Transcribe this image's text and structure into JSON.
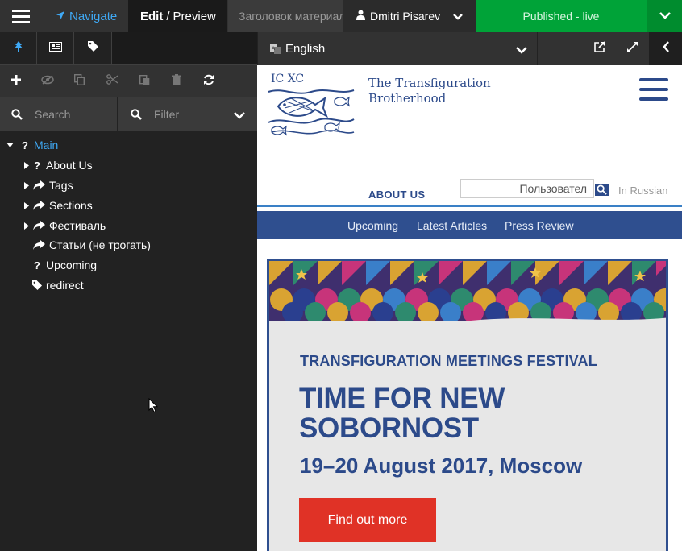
{
  "topbar": {
    "navigate_label": "Navigate",
    "edit_label": "Edit",
    "preview_label": "Preview",
    "edit_separator": "/",
    "title_field": "Заголовок материал",
    "user_name": "Dmitri Pisarev",
    "publish_status": "Published - live"
  },
  "sidebar": {
    "search_placeholder": "Search",
    "filter_placeholder": "Filter",
    "tree": [
      {
        "label": "Main",
        "icon": "question-icon",
        "expanded": true,
        "active": true
      },
      {
        "label": "About Us",
        "icon": "question-icon"
      },
      {
        "label": "Tags",
        "icon": "share-icon"
      },
      {
        "label": "Sections",
        "icon": "share-icon"
      },
      {
        "label": "Фестиваль",
        "icon": "share-icon"
      },
      {
        "label": "Статьи (не трогать)",
        "icon": "share-icon"
      },
      {
        "label": "Upcoming",
        "icon": "question-icon"
      },
      {
        "label": "redirect",
        "icon": "tag-icon"
      }
    ]
  },
  "preview": {
    "language": "English",
    "site": {
      "logo_line1": "The Transfiguration",
      "logo_line2": "Brotherhood",
      "logo_mark": "IC XC",
      "about_link": "ABOUT US",
      "user_field": "Пользовател",
      "in_russian": "In Russian",
      "nav": [
        "Upcoming",
        "Latest Articles",
        "Press Review"
      ],
      "banner": {
        "festival": "TRANSFIGURATION MEETINGS FESTIVAL",
        "headline_line1": "TIME FOR NEW",
        "headline_line2": "SOBORNOST",
        "date": "19–20 August 2017, Moscow",
        "cta": "Find out more"
      }
    }
  },
  "colors": {
    "accent_blue": "#3fa9f5",
    "publish_green": "#00a338",
    "site_blue": "#2c4a8a",
    "cta_red": "#e03226"
  }
}
